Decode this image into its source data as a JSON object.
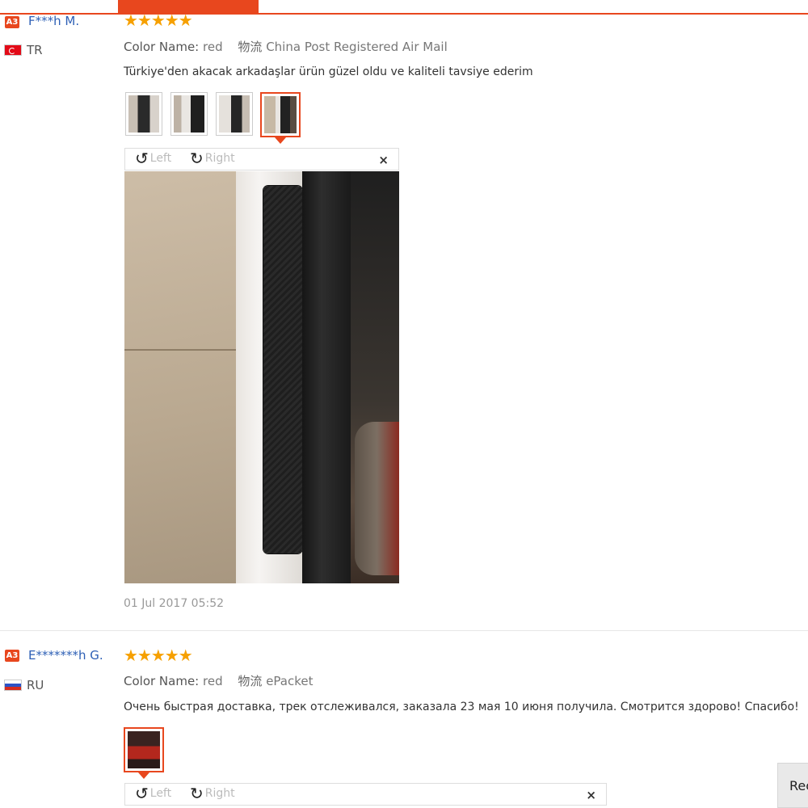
{
  "reviews": [
    {
      "badge": "A3",
      "user": "F***h M.",
      "country": "TR",
      "stars": "★★★★★",
      "color_label": "Color Name:",
      "color_value": "red",
      "shipping_label": "物流",
      "shipping_value": "China Post Registered Air Mail",
      "text": "Türkiye'den akacak arkadaşlar ürün güzel oldu ve kaliteli tavsiye ederim",
      "date": "01 Jul 2017 05:52"
    },
    {
      "badge": "A3",
      "user": "E*******h G.",
      "country": "RU",
      "stars": "★★★★★",
      "color_label": "Color Name:",
      "color_value": "red",
      "shipping_label": "物流",
      "shipping_value": "ePacket",
      "text": "Очень быстрая доставка, трек отслеживался, заказала 23 мая 10 июня получила. Смотрится здорово! Спасибо!"
    }
  ],
  "viewer": {
    "left_label": "Left",
    "right_label": "Right",
    "close_glyph": "×",
    "rotate_left_glyph": "↺",
    "rotate_right_glyph": "↻"
  },
  "side_button": {
    "label": "Rec"
  },
  "colors": {
    "accent": "#e8471e",
    "star": "#f6a000",
    "link": "#2d5fb5"
  }
}
